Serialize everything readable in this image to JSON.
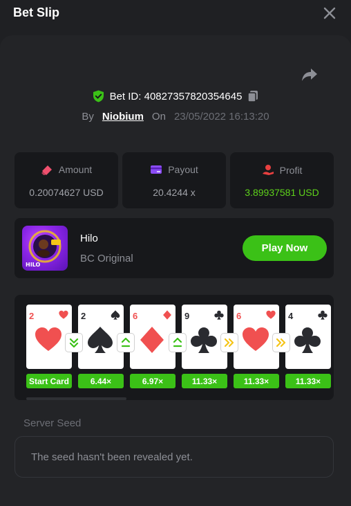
{
  "header": {
    "title": "Bet Slip",
    "close_icon": "close-icon"
  },
  "bet": {
    "id_label": "Bet ID: 40827357820354645",
    "by_label": "By",
    "user": "Niobium",
    "on_label": "On",
    "datetime": "23/05/2022 16:13:20"
  },
  "stats": [
    {
      "label": "Amount",
      "value": "0.20074627 USD",
      "icon": "amount-icon",
      "color": "#f0506e"
    },
    {
      "label": "Payout",
      "value": "20.4244 x",
      "icon": "payout-icon",
      "color": "#8b4cf6"
    },
    {
      "label": "Profit",
      "value": "3.89937581 USD",
      "icon": "profit-icon",
      "color": "#e94040"
    }
  ],
  "game": {
    "name": "Hilo",
    "provider": "BC Original",
    "play_label": "Play Now",
    "thumb_text": "HILO"
  },
  "cards": [
    {
      "rank": "2",
      "suit": "heart",
      "multiplier": "Start Card"
    },
    {
      "rank": "2",
      "suit": "spade",
      "multiplier": "6.44×"
    },
    {
      "rank": "6",
      "suit": "diamond",
      "multiplier": "6.97×"
    },
    {
      "rank": "9",
      "suit": "club",
      "multiplier": "11.33×"
    },
    {
      "rank": "6",
      "suit": "heart",
      "multiplier": "11.33×"
    },
    {
      "rank": "4",
      "suit": "club",
      "multiplier": "11.33×"
    }
  ],
  "arrows": [
    {
      "type": "lower",
      "color": "#3bc117"
    },
    {
      "type": "higher",
      "color": "#3bc117"
    },
    {
      "type": "higher",
      "color": "#3bc117"
    },
    {
      "type": "skip",
      "color": "#f5c518"
    },
    {
      "type": "skip",
      "color": "#f5c518"
    }
  ],
  "seed": {
    "label": "Server Seed",
    "text": "The seed hasn't been revealed yet."
  },
  "colors": {
    "accent": "#3bc117",
    "profit": "#5ed21b",
    "shield": "#3bc117"
  }
}
